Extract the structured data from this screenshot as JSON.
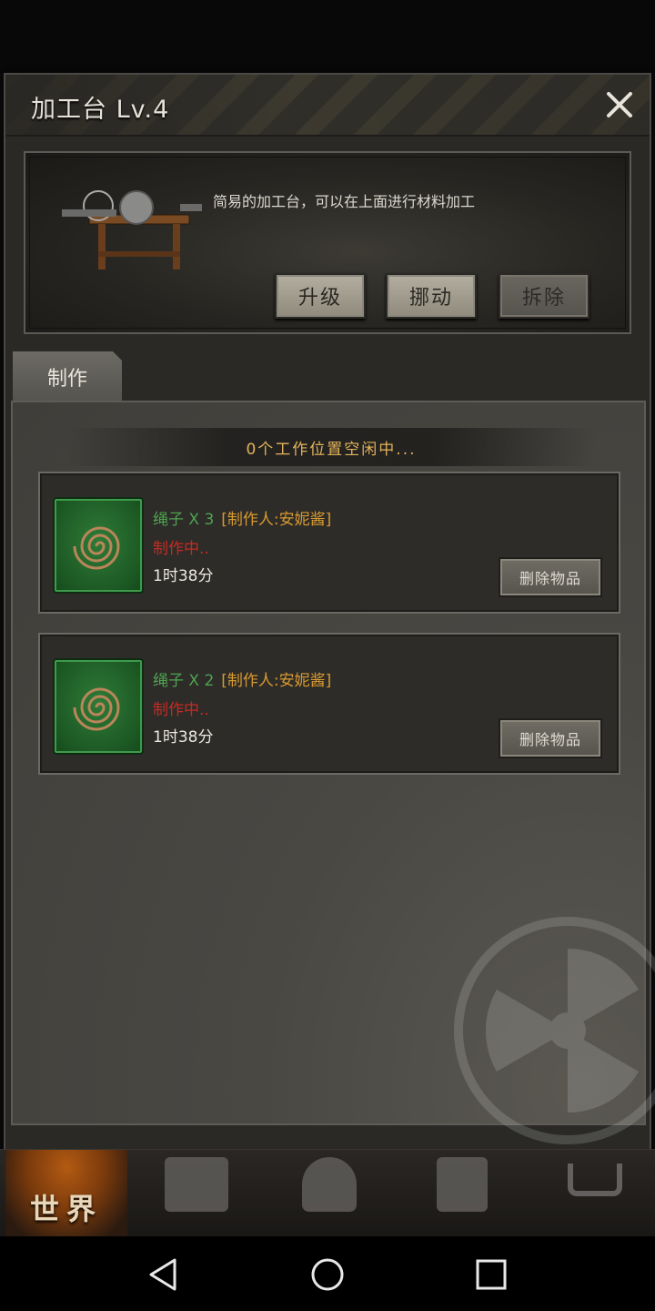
{
  "dialog": {
    "title": "加工台 Lv.4",
    "description": "简易的加工台，可以在上面进行材料加工",
    "actions": {
      "upgrade": "升级",
      "move": "挪动",
      "remove": "拆除"
    }
  },
  "tabs": [
    {
      "label": "制作"
    }
  ],
  "craft": {
    "status": "0个工作位置空闲中...",
    "items": [
      {
        "name": "绳子 X 3",
        "maker": "[制作人:安妮酱]",
        "status": "制作中..",
        "time": "1时38分",
        "delete_label": "删除物品"
      },
      {
        "name": "绳子 X 2",
        "maker": "[制作人:安妮酱]",
        "status": "制作中..",
        "time": "1时38分",
        "delete_label": "删除物品"
      }
    ]
  },
  "bottom_nav": {
    "world_label": "世界"
  },
  "colors": {
    "accent_orange": "#e2b35a",
    "item_green": "#4fa34f",
    "status_red": "#c62a22",
    "maker_orange": "#d99a2e"
  },
  "icons": [
    "close-icon",
    "workbench-icon",
    "rope-icon",
    "backpack-icon",
    "character-icon",
    "phone-icon",
    "cart-icon",
    "back-icon",
    "home-icon",
    "recent-apps-icon"
  ]
}
